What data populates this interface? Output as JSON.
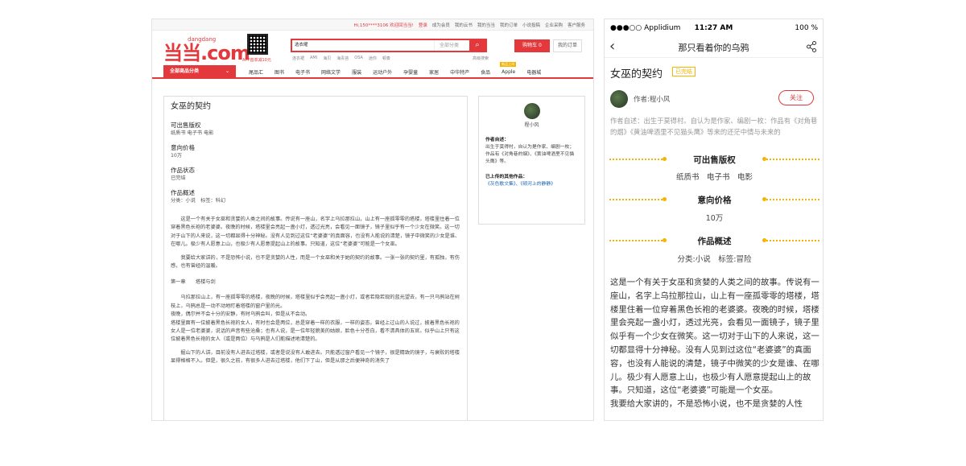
{
  "desktop": {
    "topbar": {
      "greeting": "Hi,150****3106 欢迎回当当!",
      "logout": "登录",
      "become_member": "成为会员",
      "links": [
        "我的云书",
        "我的当当",
        "我的订单",
        "小说投稿",
        "企业采购",
        "客户服务"
      ]
    },
    "header": {
      "logo_text": "dangdang",
      "logo_main": "当当.com",
      "app_caption": "APP首单减10元",
      "search_value": "选衣曜",
      "search_category": "全部分类",
      "hot_words": [
        "连衣裙",
        "AMI",
        "海贝",
        "海青苔",
        "OSA",
        "迷你",
        "顿奏"
      ],
      "advanced_search": "高级搜索",
      "cart_label": "购物车 0",
      "orders_label": "我的订单"
    },
    "nav": {
      "all_categories": "全部商品分类",
      "items": [
        "尾品汇",
        "图书",
        "电子书",
        "网络文学",
        "服装",
        "运动户外",
        "孕婴童",
        "家居",
        "中华特产",
        "食品",
        "Apple",
        "电器城"
      ],
      "apple_tag": "新品上市"
    },
    "work": {
      "title": "女巫的契约",
      "rights_label": "可出售版权",
      "rights_value": "纸质书 电子书 电影",
      "price_label": "意向价格",
      "price_value": "10万",
      "status_label": "作品状态",
      "status_value": "已完结",
      "summary_label": "作品概述",
      "summary_tags": "分类：小说　标签：科幻",
      "paragraphs": [
        "这是一个有关于女巫和贪婪的人类之间的故事。传说有一座山，名字上乌拉那拉山，山上有一座孤零零的塔楼，塔楼里住着一位穿着黑色长袍的老婆婆。夜晚的时候，塔楼里会亮起一盏小灯，透过光亮，会看见一面镜子，镜子里似乎有一个少女在微笑。这一切对于山下的人来说，这一切都显得十分神秘。没有人见到过这位“老婆婆”的真面容，也没有人能说的清楚，镜子中微笑的少女是谁、在哪儿。极少有人愿意上山，也极少有人愿意提起山上的故事。只知道，这位“老婆婆”可能是一个女巫。",
        "我要给大家讲的，不是恐怖小说，也不是贪婪的人性，而是一个女巫和关于她的契约的故事。一张一张的契约里，有孤独，有伤感，也有曾经的温暖。"
      ],
      "chapter": "第一章　　塔楼与剑",
      "chapter_paragraphs": [
        "乌拉那拉山上，有一座孤零零的塔楼，夜晚的时候，塔楼里似乎会亮起一盏小灯，或者若隐若现的蓝光望去，有一只乌鸦站在树枝上，乌鸦总是一动不动地盯着塔楼的窗户里的光。",
        "夜晚，偶尔并不会十分的安静，有时乌鸦会叫，但是从不会动。",
        "塔楼里面有一位披着黑色长袍的女人，有时也会是两位，总是穿着一样的衣服，一样的姿态。曾经上过山的人说过，披着黑色长袍的女人是一位老婆婆，说话的声音有些沧桑；也有人说，是一位年轻貌美的姑娘，脸色十分苍白，看不清具体的五官。似乎山上只有这位披着黑色长袍的女人（或是两位）与乌鸦是人们能描述地清楚的。",
        "掘山下的人讲，目前没有人进去过塔楼，或者是说没有人敢进去。只能透过窗户看见一个镜子，很是精致的镜子，与衰败的塔楼显得格格不入。但是，很久之前，有很多人进去过塔楼，他们下了山，但是从那之后便神奇的消失了"
      ]
    },
    "author_card": {
      "name": "程小风",
      "self_label": "作者自述：",
      "self_text": "出生于莫得村，自认为是作家、编剧一枚；作品有《对角巷的烟》、《黄油啤酒里不见猫头鹰》等。",
      "others_label": "已上传的其他作品：",
      "others_links": "《灰色歌文集》、《顿河上的静静》"
    }
  },
  "mobile": {
    "status": {
      "carrier": "●●●○○ Applidium",
      "time": "11:27 AM",
      "battery": "100 %"
    },
    "nav_title": "那只看着你的乌鸦",
    "title": "女巫的契约",
    "badge": "已完结",
    "author": "作者:程小风",
    "follow": "关注",
    "intro": "作者自述：出生于莫得村。自认为是作家、编剧一枚：作品有《对角巷的烟》《黄油啤酒里不见猫头鹰》等来的还茫中情与未来的",
    "rights_label": "可出售版权",
    "rights_value": "纸质书　电子书　电影",
    "price_label": "意向价格",
    "price_value": "10万",
    "summary_label": "作品概述",
    "summary_tags": "分类:小说　标签:冒险",
    "body": "这是一个有关于女巫和贪婪的人类之间的故事。传说有一座山，名字上乌拉那拉山，山上有一座孤零零的塔楼，塔楼里住着一位穿着黑色长袍的老婆婆。夜晚的时候，塔楼里会亮起一盏小灯，透过光亮，会看见一面镜子，镜子里似乎有一个少女在微笑。这一切对于山下的人来说，这一切都显得十分神秘。没有人见到过这位“老婆婆”的真面容，也没有人能说的清楚，镜子中微笑的少女是谁、在哪儿。极少有人愿意上山，也极少有人愿意提起山上的故事。只知道，这位“老婆婆”可能是一个女巫。",
    "body2": "我要给大家讲的，不是恐怖小说，也不是贪婪的人性"
  },
  "colors": {
    "accent": "#e4393c",
    "badge": "#f5b400",
    "link": "#1a66b3"
  }
}
